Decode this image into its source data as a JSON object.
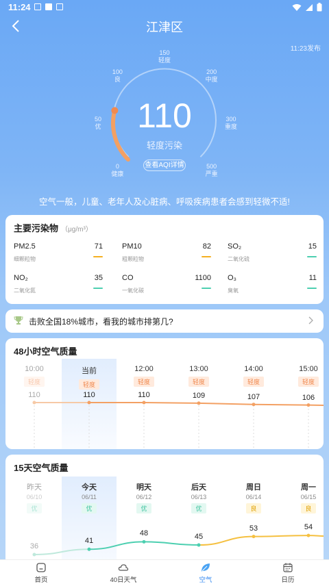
{
  "status": {
    "time": "11:24"
  },
  "header": {
    "title": "江津区"
  },
  "publish_time": "11:23发布",
  "aqi": {
    "value": "110",
    "level": "轻度污染",
    "detail_label": "查看AQI详情",
    "progress": 0.22,
    "ticks": [
      {
        "value": "0",
        "label": "健康"
      },
      {
        "value": "50",
        "label": "优"
      },
      {
        "value": "100",
        "label": "良"
      },
      {
        "value": "150",
        "label": "轻度"
      },
      {
        "value": "200",
        "label": "中度"
      },
      {
        "value": "300",
        "label": "重度"
      },
      {
        "value": "500",
        "label": "严重"
      }
    ]
  },
  "advice": "空气一般，儿童、老年人及心脏病、呼吸疾病患者会感到轻微不适!",
  "pollutants": {
    "title": "主要污染物",
    "unit": "（μg/m³）",
    "items": [
      {
        "name": "PM2.5",
        "sub": "细颗粒物",
        "value": "71",
        "color": "#f5b020"
      },
      {
        "name": "PM10",
        "sub": "粗颗粒物",
        "value": "82",
        "color": "#f5b020"
      },
      {
        "name": "SO₂",
        "sub": "二氧化硫",
        "value": "15",
        "color": "#4ccfb0"
      },
      {
        "name": "NO₂",
        "sub": "二氧化氮",
        "value": "35",
        "color": "#4ccfb0"
      },
      {
        "name": "CO",
        "sub": "一氧化碳",
        "value": "1100",
        "color": "#4ccfb0"
      },
      {
        "name": "O₃",
        "sub": "臭氧",
        "value": "11",
        "color": "#4ccfb0"
      }
    ]
  },
  "rank": {
    "text": "击败全国18%城市，看我的城市排第几?"
  },
  "hourly": {
    "title": "48小时空气质量",
    "items": [
      {
        "time": "10:00",
        "badge": "轻度",
        "value": "110",
        "past": true
      },
      {
        "time": "当前",
        "badge": "轻度",
        "value": "110",
        "past": false
      },
      {
        "time": "12:00",
        "badge": "轻度",
        "value": "110",
        "past": false
      },
      {
        "time": "13:00",
        "badge": "轻度",
        "value": "109",
        "past": false
      },
      {
        "time": "14:00",
        "badge": "轻度",
        "value": "107",
        "past": false
      },
      {
        "time": "15:00",
        "badge": "轻度",
        "value": "106",
        "past": false
      }
    ]
  },
  "daily": {
    "title": "15天空气质量",
    "items": [
      {
        "day": "昨天",
        "date": "06/10",
        "badge": "优",
        "value": "36",
        "past": true,
        "level": "good"
      },
      {
        "day": "今天",
        "date": "06/11",
        "badge": "优",
        "value": "41",
        "past": false,
        "level": "good"
      },
      {
        "day": "明天",
        "date": "06/12",
        "badge": "优",
        "value": "48",
        "past": false,
        "level": "good"
      },
      {
        "day": "后天",
        "date": "06/13",
        "badge": "优",
        "value": "45",
        "past": false,
        "level": "good"
      },
      {
        "day": "周日",
        "date": "06/14",
        "badge": "良",
        "value": "53",
        "past": false,
        "level": "moderate"
      },
      {
        "day": "周一",
        "date": "06/15",
        "badge": "良",
        "value": "54",
        "past": false,
        "level": "moderate"
      }
    ]
  },
  "tabs": [
    {
      "label": "首页",
      "icon": "home-icon",
      "active": false
    },
    {
      "label": "40日天气",
      "icon": "cloud-icon",
      "active": false
    },
    {
      "label": "空气",
      "icon": "leaf-icon",
      "active": true
    },
    {
      "label": "日历",
      "icon": "calendar-icon",
      "active": false
    }
  ],
  "colors": {
    "accent": "#3d8ef0",
    "light": "#f0a060",
    "good": "#4ccfb0",
    "moderate": "#f5c040",
    "light_badge_bg": "#ffeadd",
    "light_badge_fg": "#f08a50"
  }
}
